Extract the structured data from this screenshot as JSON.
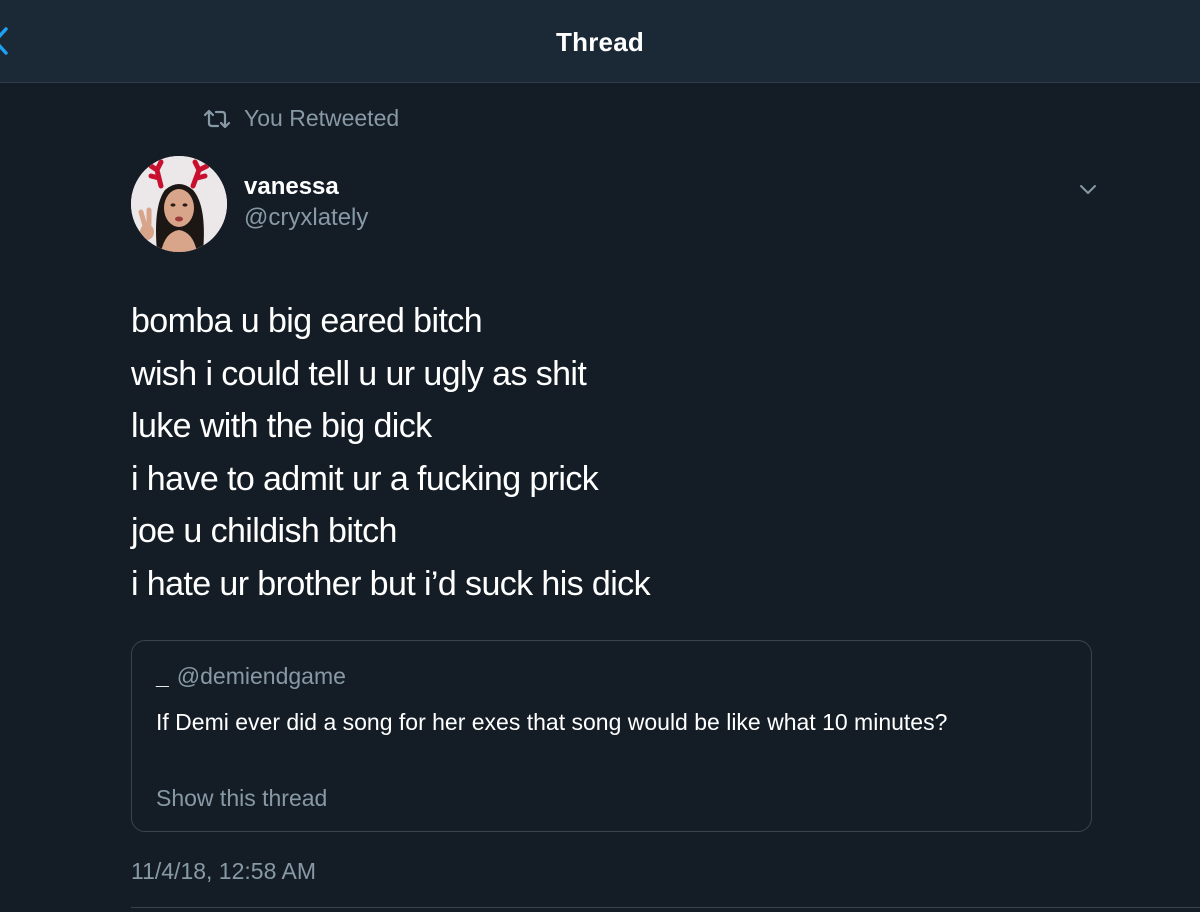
{
  "header": {
    "title": "Thread",
    "back_icon": "chevron-left-icon",
    "accent_color": "#1da1f2"
  },
  "social_context": {
    "icon": "retweet-icon",
    "label": "You Retweeted"
  },
  "tweet": {
    "author": {
      "display_name": "vanessa",
      "handle": "@cryxlately"
    },
    "menu_icon": "chevron-down-icon",
    "lines": [
      "bomba u big eared bitch",
      "wish i could tell u ur ugly as shit",
      "luke with the big dick",
      "i have to admit ur a fucking prick",
      "joe u childish bitch",
      "i hate ur brother but i’d suck his dick"
    ],
    "quoted": {
      "display_name": "_",
      "handle": "@demiendgame",
      "text": "If Demi ever did a song for her exes that song would be like what 10 minutes?",
      "show_thread": "Show this thread"
    },
    "timestamp": "11/4/18, 12:58 AM"
  },
  "colors": {
    "background": "#141d26",
    "header_background": "#1b2836",
    "secondary_text": "#8899a6",
    "border": "#38444d"
  }
}
